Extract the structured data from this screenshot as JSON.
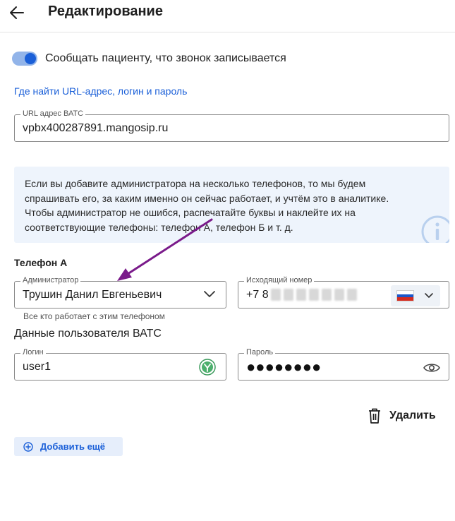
{
  "header": {
    "title": "Редактирование"
  },
  "notify_toggle": {
    "label": "Сообщать пациенту, что звонок записывается",
    "on": true
  },
  "help_link": "Где найти URL-адрес, логин и пароль",
  "url_field": {
    "label": "URL адрес ВАТС",
    "value": "vpbx400287891.mangosip.ru"
  },
  "info": {
    "text": "Если вы добавите администратора на несколько телефонов, то мы будем спрашивать его, за каким именно он сейчас работает, и учтём это в аналитике. Чтобы администратор не ошибся, распечатайте буквы и наклейте их на соответствующие телефоны: телефон А, телефон Б и т. д."
  },
  "phone_section": {
    "title": "Телефон А",
    "admin_field": {
      "label": "Администратор",
      "value": "Трушин Данил Евгеньевич"
    },
    "admin_helper": "Все кто работает с этим телефоном",
    "outgoing_field": {
      "label": "Исходящий номер",
      "value_prefix": "+7 8"
    }
  },
  "user_data": {
    "title": "Данные пользователя ВАТС",
    "login_field": {
      "label": "Логин",
      "value": "user1"
    },
    "password_field": {
      "label": "Пароль",
      "value": "●●●●●●●●"
    }
  },
  "actions": {
    "delete_label": "Удалить",
    "add_more_label": "Добавить ещё"
  },
  "colors": {
    "accent": "#1a5fd8",
    "toggle_track": "#92b4e9",
    "info_bg": "#eef4fc",
    "annotation_arrow": "#7a1a8a"
  },
  "icons": [
    "back-arrow-icon",
    "info-icon",
    "chevron-down-icon",
    "russia-flag-icon",
    "password-manager-icon",
    "eye-icon",
    "trash-icon",
    "plus-circle-icon"
  ]
}
